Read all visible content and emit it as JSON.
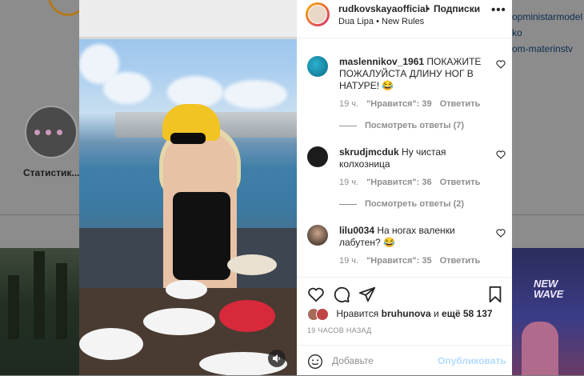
{
  "background": {
    "highlight_label": "Статистик...",
    "right_texts": [
      "opministarmodel",
      "ko",
      "om-materinstv"
    ],
    "right_tile_text": "NEW WAVE"
  },
  "post": {
    "username": "rudkovskayaofficial",
    "dot": "•",
    "follow_label": "Подписки",
    "audio": "Dua Lipa • New Rules",
    "more": "•••"
  },
  "comments": [
    {
      "username": "maslennikov_1961",
      "text": "ПОКАЖИТЕ ПОЖАЛУЙСТА ДЛИНУ НОГ В НАТУРЕ! 😂",
      "time": "19 ч.",
      "likes": "\"Нравится\": 39",
      "reply": "Ответить",
      "view_replies": "Посмотреть ответы (7)"
    },
    {
      "username": "skrudjmcduk",
      "text": "Ну чистая колхозница",
      "time": "19 ч.",
      "likes": "\"Нравится\": 36",
      "reply": "Ответить",
      "view_replies": "Посмотреть ответы (2)"
    },
    {
      "username": "lilu0034",
      "text": "На ногах валенки лабутен? 😂",
      "time": "19 ч.",
      "likes": "\"Нравится\": 35",
      "reply": "Ответить"
    }
  ],
  "likes_line": {
    "prefix": "Нравится",
    "user": "bruhunova",
    "conj": "и",
    "count": "ещё 58 137"
  },
  "timestamp": "19 ЧАСОВ НАЗАД",
  "add_comment": {
    "placeholder": "Добавьте",
    "publish": "Опубликовать"
  }
}
